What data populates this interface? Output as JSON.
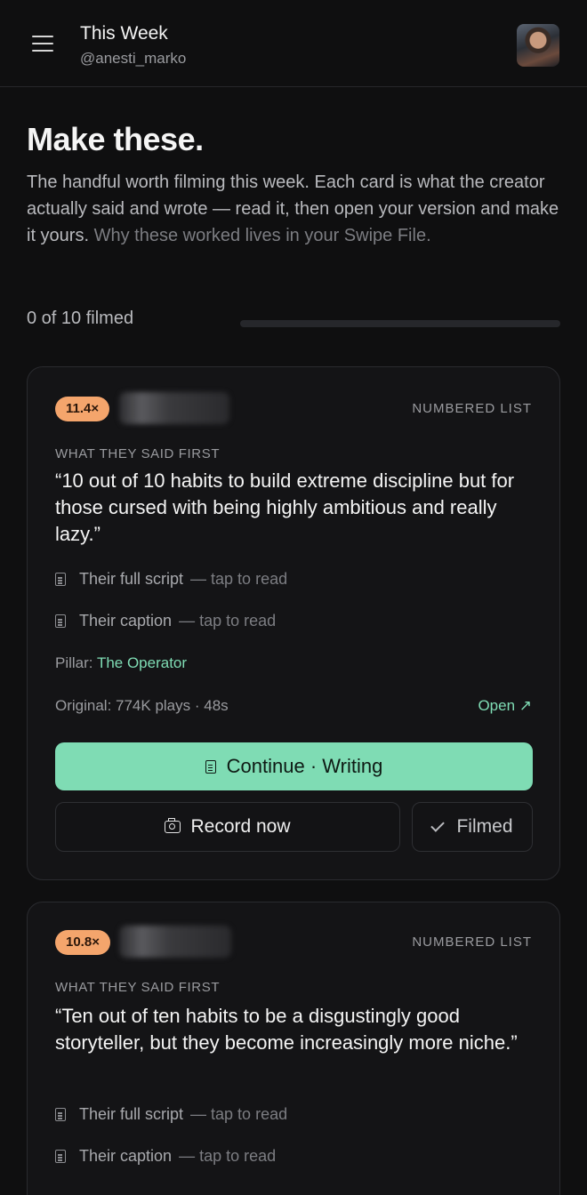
{
  "header": {
    "title": "This Week",
    "handle": "@anesti_marko",
    "menu_icon": "hamburger-icon",
    "avatar": "profile-avatar"
  },
  "intro": {
    "title": "Make these.",
    "body": "The handful worth filming this week. Each card is what the creator actually said and wrote — read it, then open your version and make it yours.",
    "body_muted": " Why these worked lives in your Swipe File."
  },
  "progress": {
    "label": "0 of 10 filmed",
    "filmed": 0,
    "total": 10
  },
  "cards": [
    {
      "multiplier": "11.4×",
      "format": "NUMBERED LIST",
      "said_label": "WHAT THEY SAID FIRST",
      "quote": "“10 out of 10 habits to build extreme discipline but for those cursed with being highly ambitious and really lazy.”",
      "script_label": "Their full script",
      "script_hint": "— tap to read",
      "caption_label": "Their caption",
      "caption_hint": "— tap to read",
      "pillar_label": "Pillar:",
      "pillar_value": "The Operator",
      "original": "Original: 774K plays · 48s",
      "open_label": "Open ↗",
      "primary_button": "Continue · Writing",
      "record_button": "Record now",
      "filmed_button": "Filmed"
    },
    {
      "multiplier": "10.8×",
      "format": "NUMBERED LIST",
      "said_label": "WHAT THEY SAID FIRST",
      "quote": "“Ten out of ten habits to be a disgustingly good storyteller, but they become increasingly more niche.”",
      "script_label": "Their full script",
      "script_hint": "— tap to read",
      "caption_label": "Their caption",
      "caption_hint": "— tap to read"
    }
  ],
  "colors": {
    "background": "#0f0f10",
    "accent": "#7fdcb4",
    "badge": "#f4a56c"
  }
}
